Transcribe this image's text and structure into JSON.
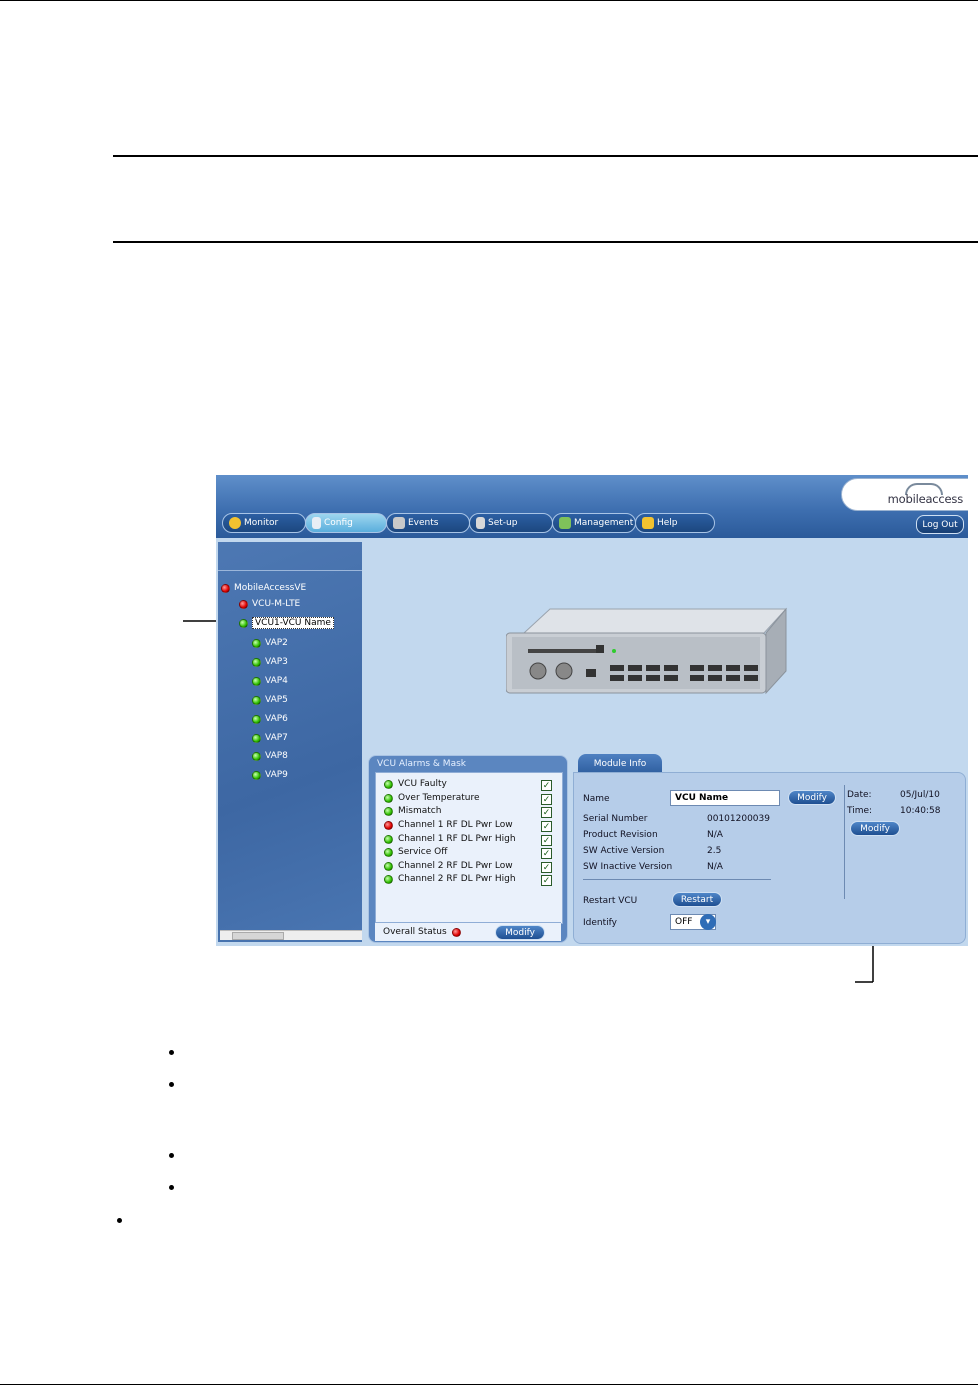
{
  "app": {
    "logo_text": "mobileaccess",
    "tabs": [
      {
        "label": "Monitor",
        "active": false
      },
      {
        "label": "Config",
        "active": true
      },
      {
        "label": "Events",
        "active": false
      },
      {
        "label": "Set-up",
        "active": false
      },
      {
        "label": "Management",
        "active": false
      },
      {
        "label": "Help",
        "active": false
      }
    ],
    "logout_label": "Log Out",
    "tree": {
      "items": [
        {
          "label": "MobileAccessVE",
          "status": "red"
        },
        {
          "label": "VCU-M-LTE",
          "status": "red"
        },
        {
          "label": "VCU1-VCU Name",
          "status": "green",
          "selected": true
        },
        {
          "label": "VAP2",
          "status": "green"
        },
        {
          "label": "VAP3",
          "status": "green"
        },
        {
          "label": "VAP4",
          "status": "green"
        },
        {
          "label": "VAP5",
          "status": "green"
        },
        {
          "label": "VAP6",
          "status": "green"
        },
        {
          "label": "VAP7",
          "status": "green"
        },
        {
          "label": "VAP8",
          "status": "green"
        },
        {
          "label": "VAP9",
          "status": "green"
        }
      ]
    },
    "alarms": {
      "title": "VCU Alarms & Mask",
      "items": [
        {
          "label": "VCU Faulty",
          "status": "green",
          "masked": true
        },
        {
          "label": "Over Temperature",
          "status": "green",
          "masked": true
        },
        {
          "label": "Mismatch",
          "status": "green",
          "masked": true
        },
        {
          "label": "Channel 1 RF DL Pwr Low",
          "status": "red",
          "masked": true
        },
        {
          "label": "Channel 1 RF DL Pwr High",
          "status": "green",
          "masked": true
        },
        {
          "label": "Service Off",
          "status": "green",
          "masked": true
        },
        {
          "label": "Channel 2 RF DL Pwr Low",
          "status": "green",
          "masked": true
        },
        {
          "label": "Channel 2 RF DL Pwr High",
          "status": "green",
          "masked": true
        }
      ],
      "overall_label": "Overall Status",
      "overall_status": "red",
      "modify_label": "Modify"
    },
    "module": {
      "tab_label": "Module Info",
      "name_label": "Name",
      "name_value": "VCU Name",
      "name_modify_label": "Modify",
      "serial_label": "Serial Number",
      "serial_value": "00101200039",
      "revision_label": "Product Revision",
      "revision_value": "N/A",
      "sw_active_label": "SW Active Version",
      "sw_active_value": "2.5",
      "sw_inactive_label": "SW Inactive Version",
      "sw_inactive_value": "N/A",
      "date_label": "Date:",
      "date_value": "05/Jul/10",
      "time_label": "Time:",
      "time_value": "10:40:58",
      "datetime_modify_label": "Modify",
      "restart_label": "Restart VCU",
      "restart_button": "Restart",
      "identify_label": "Identify",
      "identify_value": "OFF"
    },
    "colors": {
      "header_blue": "#3e6fb0",
      "content_bg": "#c2d8ee",
      "led_red": "#e00000",
      "led_green": "#30c000"
    }
  }
}
